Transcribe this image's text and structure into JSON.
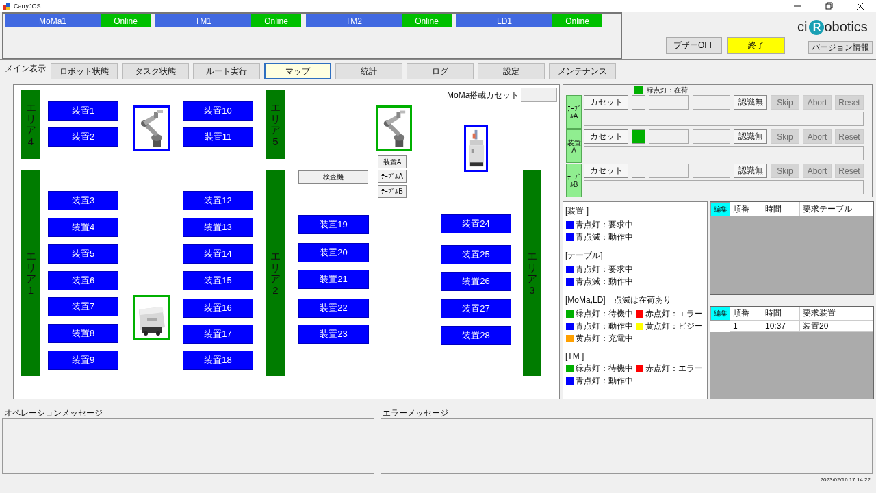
{
  "window": {
    "title": "CarryJOS"
  },
  "robot_status": [
    {
      "name": "MoMa1",
      "status": "Online"
    },
    {
      "name": "TM1",
      "status": "Online"
    },
    {
      "name": "TM2",
      "status": "Online"
    },
    {
      "name": "LD1",
      "status": "Online"
    }
  ],
  "buzzer_button": "ブザーOFF",
  "exit_button": "終了",
  "logo": {
    "prefix": "ci",
    "mark": "R",
    "suffix": "obotics"
  },
  "version_button": "バージョン情報",
  "main_label": "メイン表示",
  "tabs": [
    {
      "label": "ロボット状態",
      "selected": false
    },
    {
      "label": "タスク状態",
      "selected": false
    },
    {
      "label": "ルート実行",
      "selected": false
    },
    {
      "label": "マップ",
      "selected": true
    },
    {
      "label": "統計",
      "selected": false
    },
    {
      "label": "ログ",
      "selected": false
    },
    {
      "label": "設定",
      "selected": false
    },
    {
      "label": "メンテナンス",
      "selected": false
    }
  ],
  "map": {
    "cassette_label": "MoMa搭載カセット",
    "areas": [
      {
        "label": "エリア4"
      },
      {
        "label": "エリア1"
      },
      {
        "label": "エリア5"
      },
      {
        "label": "エリア2"
      },
      {
        "label": "エリア3"
      }
    ],
    "devices": [
      {
        "label": "装置1"
      },
      {
        "label": "装置2"
      },
      {
        "label": "装置3"
      },
      {
        "label": "装置4"
      },
      {
        "label": "装置5"
      },
      {
        "label": "装置6"
      },
      {
        "label": "装置7"
      },
      {
        "label": "装置8"
      },
      {
        "label": "装置9"
      },
      {
        "label": "装置10"
      },
      {
        "label": "装置11"
      },
      {
        "label": "装置12"
      },
      {
        "label": "装置13"
      },
      {
        "label": "装置14"
      },
      {
        "label": "装置15"
      },
      {
        "label": "装置16"
      },
      {
        "label": "装置17"
      },
      {
        "label": "装置18"
      },
      {
        "label": "装置19"
      },
      {
        "label": "装置20"
      },
      {
        "label": "装置21"
      },
      {
        "label": "装置22"
      },
      {
        "label": "装置23"
      },
      {
        "label": "装置24"
      },
      {
        "label": "装置25"
      },
      {
        "label": "装置26"
      },
      {
        "label": "装置27"
      },
      {
        "label": "装置28"
      }
    ],
    "robots": [
      {
        "kind": "arm",
        "color": "#0000ff"
      },
      {
        "kind": "arm",
        "color": "#00b000"
      },
      {
        "kind": "moma",
        "color": "#0000ff"
      },
      {
        "kind": "amr",
        "color": "#00b000"
      }
    ],
    "stations": [
      {
        "label": "検査機"
      },
      {
        "label": "装置A"
      },
      {
        "label": "ﾃｰﾌﾞﾙA"
      },
      {
        "label": "ﾃｰﾌﾞﾙB"
      }
    ]
  },
  "stations_panel": {
    "legend": {
      "label": "緑点灯：在荷",
      "color": "#00b000"
    },
    "rows": [
      {
        "label": "ﾃｰﾌﾞﾙA",
        "cassette_button": "カセット",
        "loaded": false,
        "recognize_button": "認識無",
        "actions": [
          {
            "label": "Skip",
            "disabled": true
          },
          {
            "label": "Abort",
            "disabled": true
          },
          {
            "label": "Reset",
            "disabled": true
          }
        ]
      },
      {
        "label": "装置A",
        "cassette_button": "カセット",
        "loaded": true,
        "recognize_button": "認識無",
        "actions": [
          {
            "label": "Skip",
            "disabled": true
          },
          {
            "label": "Abort",
            "disabled": true
          },
          {
            "label": "Reset",
            "disabled": true
          }
        ]
      },
      {
        "label": "ﾃｰﾌﾞﾙB",
        "cassette_button": "カセット",
        "loaded": false,
        "recognize_button": "認識無",
        "actions": [
          {
            "label": "Skip",
            "disabled": true
          },
          {
            "label": "Abort",
            "disabled": true
          },
          {
            "label": "Reset",
            "disabled": true
          }
        ]
      }
    ]
  },
  "legend": [
    {
      "title": "[装置 ]",
      "rows": [
        [
          {
            "label": "青点灯：要求中",
            "color": "#0000ff"
          }
        ],
        [
          {
            "label": "青点滅：動作中",
            "color": "#0000ff"
          }
        ]
      ]
    },
    {
      "title": "[テーブル]",
      "rows": [
        [
          {
            "label": "青点灯：要求中",
            "color": "#0000ff"
          }
        ],
        [
          {
            "label": "青点滅：動作中",
            "color": "#0000ff"
          }
        ]
      ]
    },
    {
      "title": "[MoMa,LD]　点滅は在荷あり",
      "rows": [
        [
          {
            "label": "緑点灯：待機中",
            "color": "#00b000"
          },
          {
            "label": "赤点灯：エラー",
            "color": "#ff0000"
          }
        ],
        [
          {
            "label": "青点灯：動作中",
            "color": "#0000ff"
          },
          {
            "label": "黄点灯：ビジー",
            "color": "#ffff00"
          }
        ],
        [
          {
            "label": "黄点灯：充電中",
            "color": "#ffa000"
          }
        ]
      ]
    },
    {
      "title": "[TM ]",
      "rows": [
        [
          {
            "label": "緑点灯：待機中",
            "color": "#00b000"
          },
          {
            "label": "赤点灯：エラー",
            "color": "#ff0000"
          }
        ],
        [
          {
            "label": "青点灯：動作中",
            "color": "#0000ff"
          }
        ]
      ]
    }
  ],
  "request_tables": [
    {
      "corner": "編集",
      "columns": [
        "順番",
        "時間",
        "要求テーブル"
      ]
    },
    {
      "corner": "編集",
      "columns": [
        "順番",
        "時間",
        "要求装置"
      ],
      "rows": [
        [
          "1",
          "10:37",
          "装置20"
        ]
      ]
    }
  ],
  "operation_message": {
    "label": "オペレーションメッセージ"
  },
  "error_message": {
    "label": "エラーメッセージ"
  },
  "status_bar": {
    "timestamp": "2023/02/16 17:14:22"
  }
}
